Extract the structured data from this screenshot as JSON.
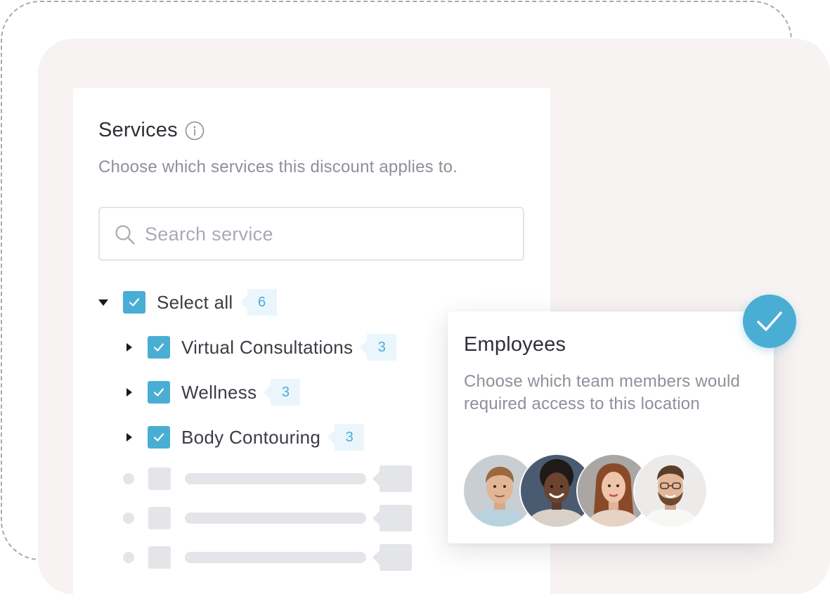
{
  "services": {
    "title": "Services",
    "subtitle": "Choose which services this discount applies to.",
    "search": {
      "placeholder": "Search service",
      "value": ""
    },
    "select_all": {
      "label": "Select all",
      "count": "6",
      "checked": true
    },
    "items": [
      {
        "label": "Virtual Consultations",
        "count": "3",
        "checked": true
      },
      {
        "label": "Wellness",
        "count": "3",
        "checked": true
      },
      {
        "label": "Body Contouring",
        "count": "3",
        "checked": true
      }
    ]
  },
  "employees": {
    "title": "Employees",
    "description": "Choose which team members would required access to this location",
    "selected": true
  },
  "colors": {
    "accent": "#4aaed4",
    "badge_bg": "#eaf6fc",
    "panel_bg": "#f7f3f2",
    "placeholder": "#e4e5e9"
  },
  "icons": [
    "info-icon",
    "search-icon",
    "caret-down-icon",
    "caret-right-icon",
    "checkmark-icon",
    "check-circle-icon"
  ]
}
